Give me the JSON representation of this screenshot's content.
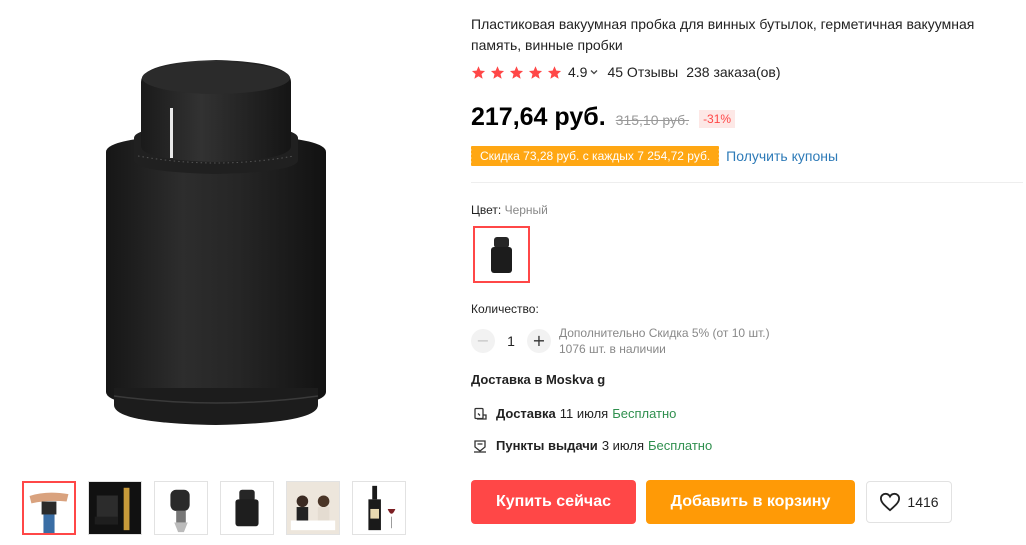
{
  "product": {
    "title": "Пластиковая вакуумная пробка для винных бутылок, герметичная вакуумная память, винные пробки",
    "rating": "4.9",
    "stars": 5,
    "reviews": "45 Отзывы",
    "orders": "238 заказа(ов)",
    "price": "217,64 руб.",
    "old_price": "315,10 руб.",
    "discount": "-31%",
    "coupon_text": "Скидка 73,28 руб. с каждых 7 254,72 руб.",
    "coupon_link": "Получить купоны"
  },
  "color": {
    "label": "Цвет:",
    "value": "Черный"
  },
  "quantity": {
    "label": "Количество:",
    "value": "1",
    "minus": "−",
    "plus": "+",
    "note_discount": "Дополнительно Скидка 5% (от 10 шт.)",
    "note_stock": "1076 шт. в наличии"
  },
  "delivery": {
    "to": "Доставка в Moskva g",
    "rows": [
      {
        "label": "Доставка",
        "date": "11 июля",
        "cost": "Бесплатно",
        "icon": "truck-icon"
      },
      {
        "label": "Пункты выдачи",
        "date": "3 июля",
        "cost": "Бесплатно",
        "icon": "pickup-point-icon"
      }
    ]
  },
  "actions": {
    "buy": "Купить сейчас",
    "cart": "Добавить в корзину",
    "wishlist_count": "1416"
  },
  "colors": {
    "accent": "#ff4747",
    "orange": "#ff9a06",
    "coupon": "#ffa713",
    "link": "#2e7bb8",
    "free": "#2f8f4e",
    "product": "#2a2a2a"
  },
  "gallery": {
    "thumbnails": [
      "thumb-hand-on-stopper",
      "thumb-stopper-with-glass",
      "thumb-stopper-pump",
      "thumb-black-stopper",
      "thumb-people-dining",
      "thumb-wine-bottles"
    ]
  }
}
